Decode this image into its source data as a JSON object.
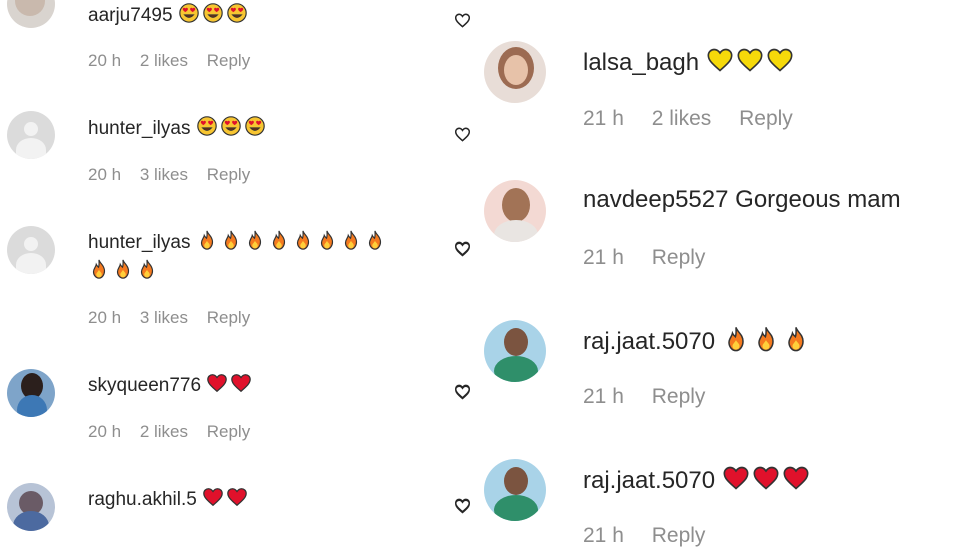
{
  "colors": {
    "text": "#262626",
    "meta": "#8e8e8e",
    "heart_red": "#e0112b",
    "heart_yellow": "#f5d90a",
    "fire_orange": "#f47a1f",
    "smile_yellow": "#f7c531"
  },
  "left_comments": [
    {
      "username": "aarju7495",
      "text": "",
      "emojis": [
        "heart-eyes",
        "heart-eyes",
        "heart-eyes"
      ],
      "emojis2": [],
      "time": "20 h",
      "likes": "2 likes",
      "reply": "Reply"
    },
    {
      "username": "hunter_ilyas",
      "text": "",
      "emojis": [
        "heart-eyes",
        "heart-eyes",
        "heart-eyes"
      ],
      "emojis2": [],
      "time": "20 h",
      "likes": "3 likes",
      "reply": "Reply"
    },
    {
      "username": "hunter_ilyas",
      "text": "",
      "emojis": [
        "fire",
        "fire",
        "fire",
        "fire",
        "fire",
        "fire",
        "fire",
        "fire"
      ],
      "emojis2": [
        "fire",
        "fire",
        "fire"
      ],
      "time": "20 h",
      "likes": "3 likes",
      "reply": "Reply"
    },
    {
      "username": "skyqueen776",
      "text": "",
      "emojis": [
        "red-heart",
        "red-heart"
      ],
      "emojis2": [],
      "time": "20 h",
      "likes": "2 likes",
      "reply": "Reply"
    },
    {
      "username": "raghu.akhil.5",
      "text": "",
      "emojis": [
        "red-heart",
        "red-heart"
      ],
      "emojis2": [],
      "time": "",
      "likes": "",
      "reply": ""
    }
  ],
  "right_comments": [
    {
      "username": "lalsa_bagh",
      "text": "",
      "emojis": [
        "yellow-heart",
        "yellow-heart",
        "yellow-heart"
      ],
      "time": "21 h",
      "likes": "2 likes",
      "reply": "Reply"
    },
    {
      "username": "navdeep5527",
      "text": "Gorgeous mam",
      "emojis": [],
      "time": "21 h",
      "likes": "",
      "reply": "Reply"
    },
    {
      "username": "raj.jaat.5070",
      "text": "",
      "emojis": [
        "fire",
        "fire",
        "fire"
      ],
      "time": "21 h",
      "likes": "",
      "reply": "Reply"
    },
    {
      "username": "raj.jaat.5070",
      "text": "",
      "emojis": [
        "red-heart",
        "red-heart",
        "red-heart"
      ],
      "time": "21 h",
      "likes": "",
      "reply": "Reply"
    }
  ],
  "icons": {
    "like": "heart-outline-icon",
    "default_avatar": "default-avatar-icon"
  }
}
